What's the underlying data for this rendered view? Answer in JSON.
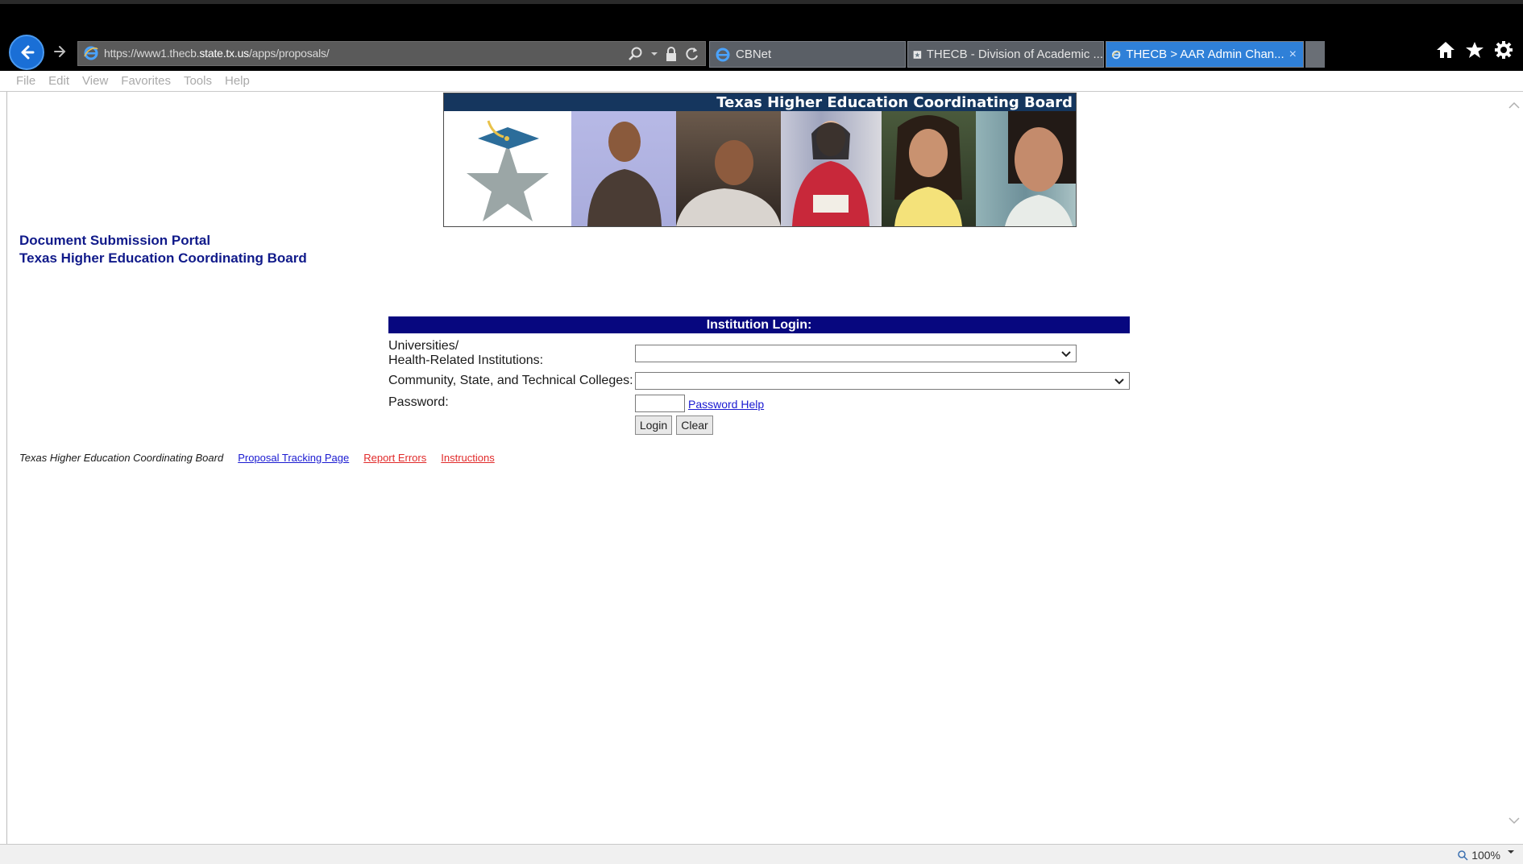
{
  "browser": {
    "url_prefix": "https://",
    "url_domain_pre": "www1.thecb.",
    "url_domain": "state.tx.us",
    "url_path": "/apps/proposals/",
    "tabs": [
      {
        "label": "CBNet",
        "active": false
      },
      {
        "label": "THECB - Division of Academic ...",
        "active": false
      },
      {
        "label": "THECB > AAR Admin Chan...",
        "active": true
      }
    ],
    "tab_close": "×",
    "menu": [
      "File",
      "Edit",
      "View",
      "Favorites",
      "Tools",
      "Help"
    ],
    "zoom": "100%"
  },
  "banner": {
    "title": "Texas Higher Education Coordinating Board"
  },
  "portal": {
    "line1": "Document Submission Portal",
    "line2": "Texas Higher Education Coordinating Board"
  },
  "login": {
    "header": "Institution Login:",
    "univ_label_1": "Universities/",
    "univ_label_2": "Health-Related Institutions:",
    "univ_value": "",
    "college_label": "Community, State, and Technical Colleges:",
    "college_value": "",
    "password_label": "Password:",
    "password_value": "",
    "password_help": "Password Help",
    "login_button": "Login",
    "clear_button": "Clear"
  },
  "footer": {
    "org": "Texas Higher Education Coordinating Board",
    "tracking": "Proposal Tracking Page",
    "errors": "Report Errors",
    "instructions": "Instructions"
  },
  "colors": {
    "chrome_bg": "#000000",
    "active_tab": "#2f80d8",
    "login_header": "#07077f",
    "title_text": "#101a8a",
    "link_blue": "#1a1ad1",
    "link_red": "#e12a2a"
  }
}
